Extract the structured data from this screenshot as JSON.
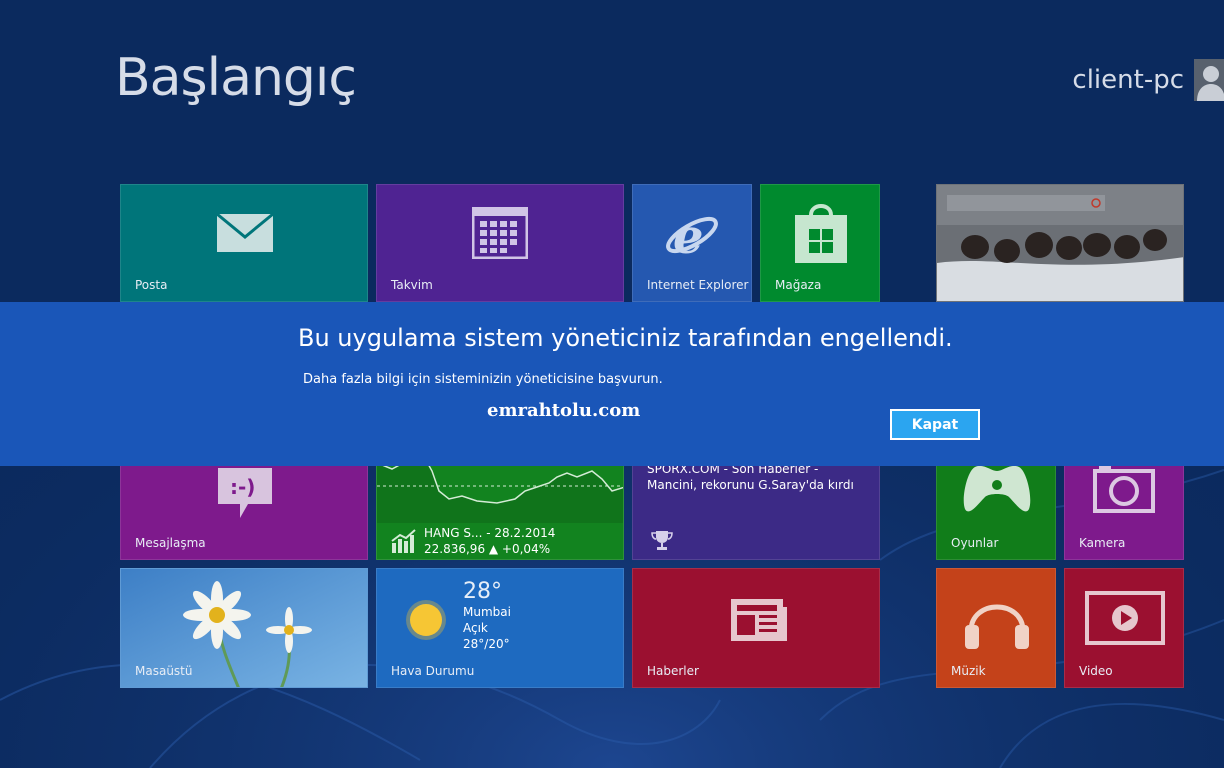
{
  "header": {
    "title": "Başlangıç",
    "user_name": "client-pc"
  },
  "tiles": {
    "mail": {
      "label": "Posta",
      "color": "#00757a"
    },
    "calendar": {
      "label": "Takvim",
      "color": "#4f2392"
    },
    "ie": {
      "label": "Internet Explorer",
      "color": "#2558b0"
    },
    "store": {
      "label": "Mağaza",
      "color": "#008a2e"
    },
    "messaging": {
      "label": "Mesajlaşma",
      "color": "#7e1a8c"
    },
    "finance": {
      "line1": "HANG S... - 28.2.2014",
      "line2": "22.836,96 ▲ +0,04%",
      "color": "#12831f"
    },
    "sports": {
      "text": "SPORX.COM - Son Haberler - Mancini, rekorunu G.Saray'da kırdı",
      "color": "#3c2a86"
    },
    "games": {
      "label": "Oyunlar",
      "color": "#117d1a"
    },
    "camera": {
      "label": "Kamera",
      "color": "#7e1a8c"
    },
    "desktop": {
      "label": "Masaüstü"
    },
    "weather": {
      "label": "Hava Durumu",
      "temp": "28°",
      "city": "Mumbai",
      "condition": "Açık",
      "range": "28°/20°",
      "color": "#1e6ac0"
    },
    "news": {
      "label": "Haberler",
      "color": "#9b1030"
    },
    "music": {
      "label": "Müzik",
      "color": "#c4421a"
    },
    "video": {
      "label": "Video",
      "color": "#9b1030"
    }
  },
  "dialog": {
    "title": "Bu uygulama sistem yöneticiniz tarafından engellendi.",
    "message": "Daha fazla bilgi için sisteminizin yöneticisine başvurun.",
    "watermark": "emrahtolu.com",
    "close_label": "Kapat"
  }
}
